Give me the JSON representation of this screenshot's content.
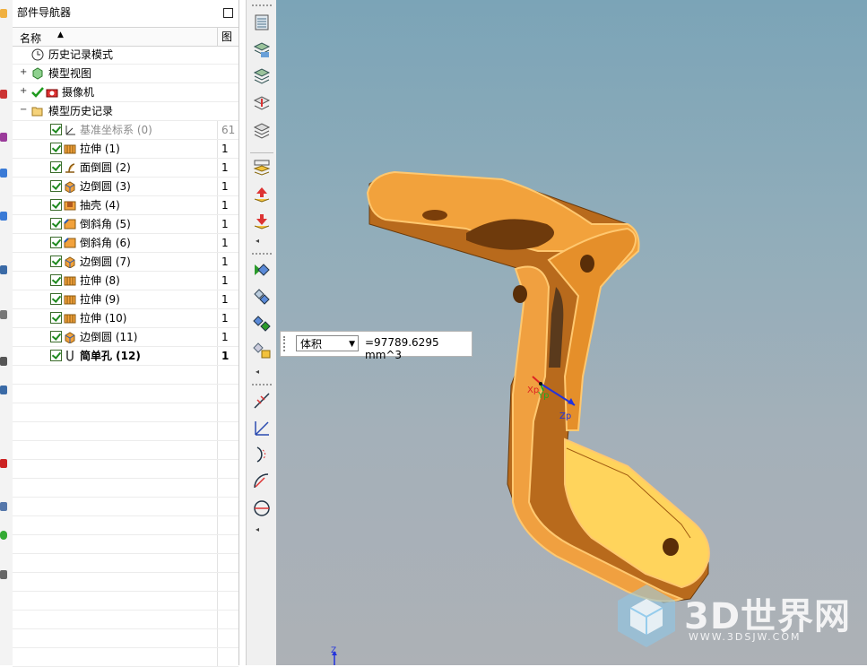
{
  "navigator": {
    "title": "部件导航器",
    "col_name": "名称",
    "col_2": "图",
    "rows": [
      {
        "label": "历史记录模式",
        "num": ""
      },
      {
        "label": "模型视图",
        "num": ""
      },
      {
        "label": "摄像机",
        "num": ""
      },
      {
        "label": "模型历史记录",
        "num": ""
      },
      {
        "label": "基准坐标系 (0)",
        "num": "61"
      },
      {
        "label": "拉伸 (1)",
        "num": "1"
      },
      {
        "label": "面倒圆 (2)",
        "num": "1"
      },
      {
        "label": "边倒圆 (3)",
        "num": "1"
      },
      {
        "label": "抽壳 (4)",
        "num": "1"
      },
      {
        "label": "倒斜角 (5)",
        "num": "1"
      },
      {
        "label": "倒斜角 (6)",
        "num": "1"
      },
      {
        "label": "边倒圆 (7)",
        "num": "1"
      },
      {
        "label": "拉伸 (8)",
        "num": "1"
      },
      {
        "label": "拉伸 (9)",
        "num": "1"
      },
      {
        "label": "拉伸 (10)",
        "num": "1"
      },
      {
        "label": "边倒圆 (11)",
        "num": "1"
      },
      {
        "label": "简单孔 (12)",
        "num": "1"
      }
    ]
  },
  "measure": {
    "type": "体积",
    "value": "=97789.6295 mm^3"
  },
  "viewport": {
    "axis_x": "Xp",
    "axis_y": "Yp",
    "axis_z": "Zp",
    "abs_z": "Z"
  },
  "watermark": {
    "brand": "3D世界网",
    "url": "WWW.3DSJW.COM"
  },
  "colors": {
    "part_orange": "#f2a23c",
    "viewport_top": "#7ba4b7",
    "viewport_bottom": "#adb1b6"
  }
}
